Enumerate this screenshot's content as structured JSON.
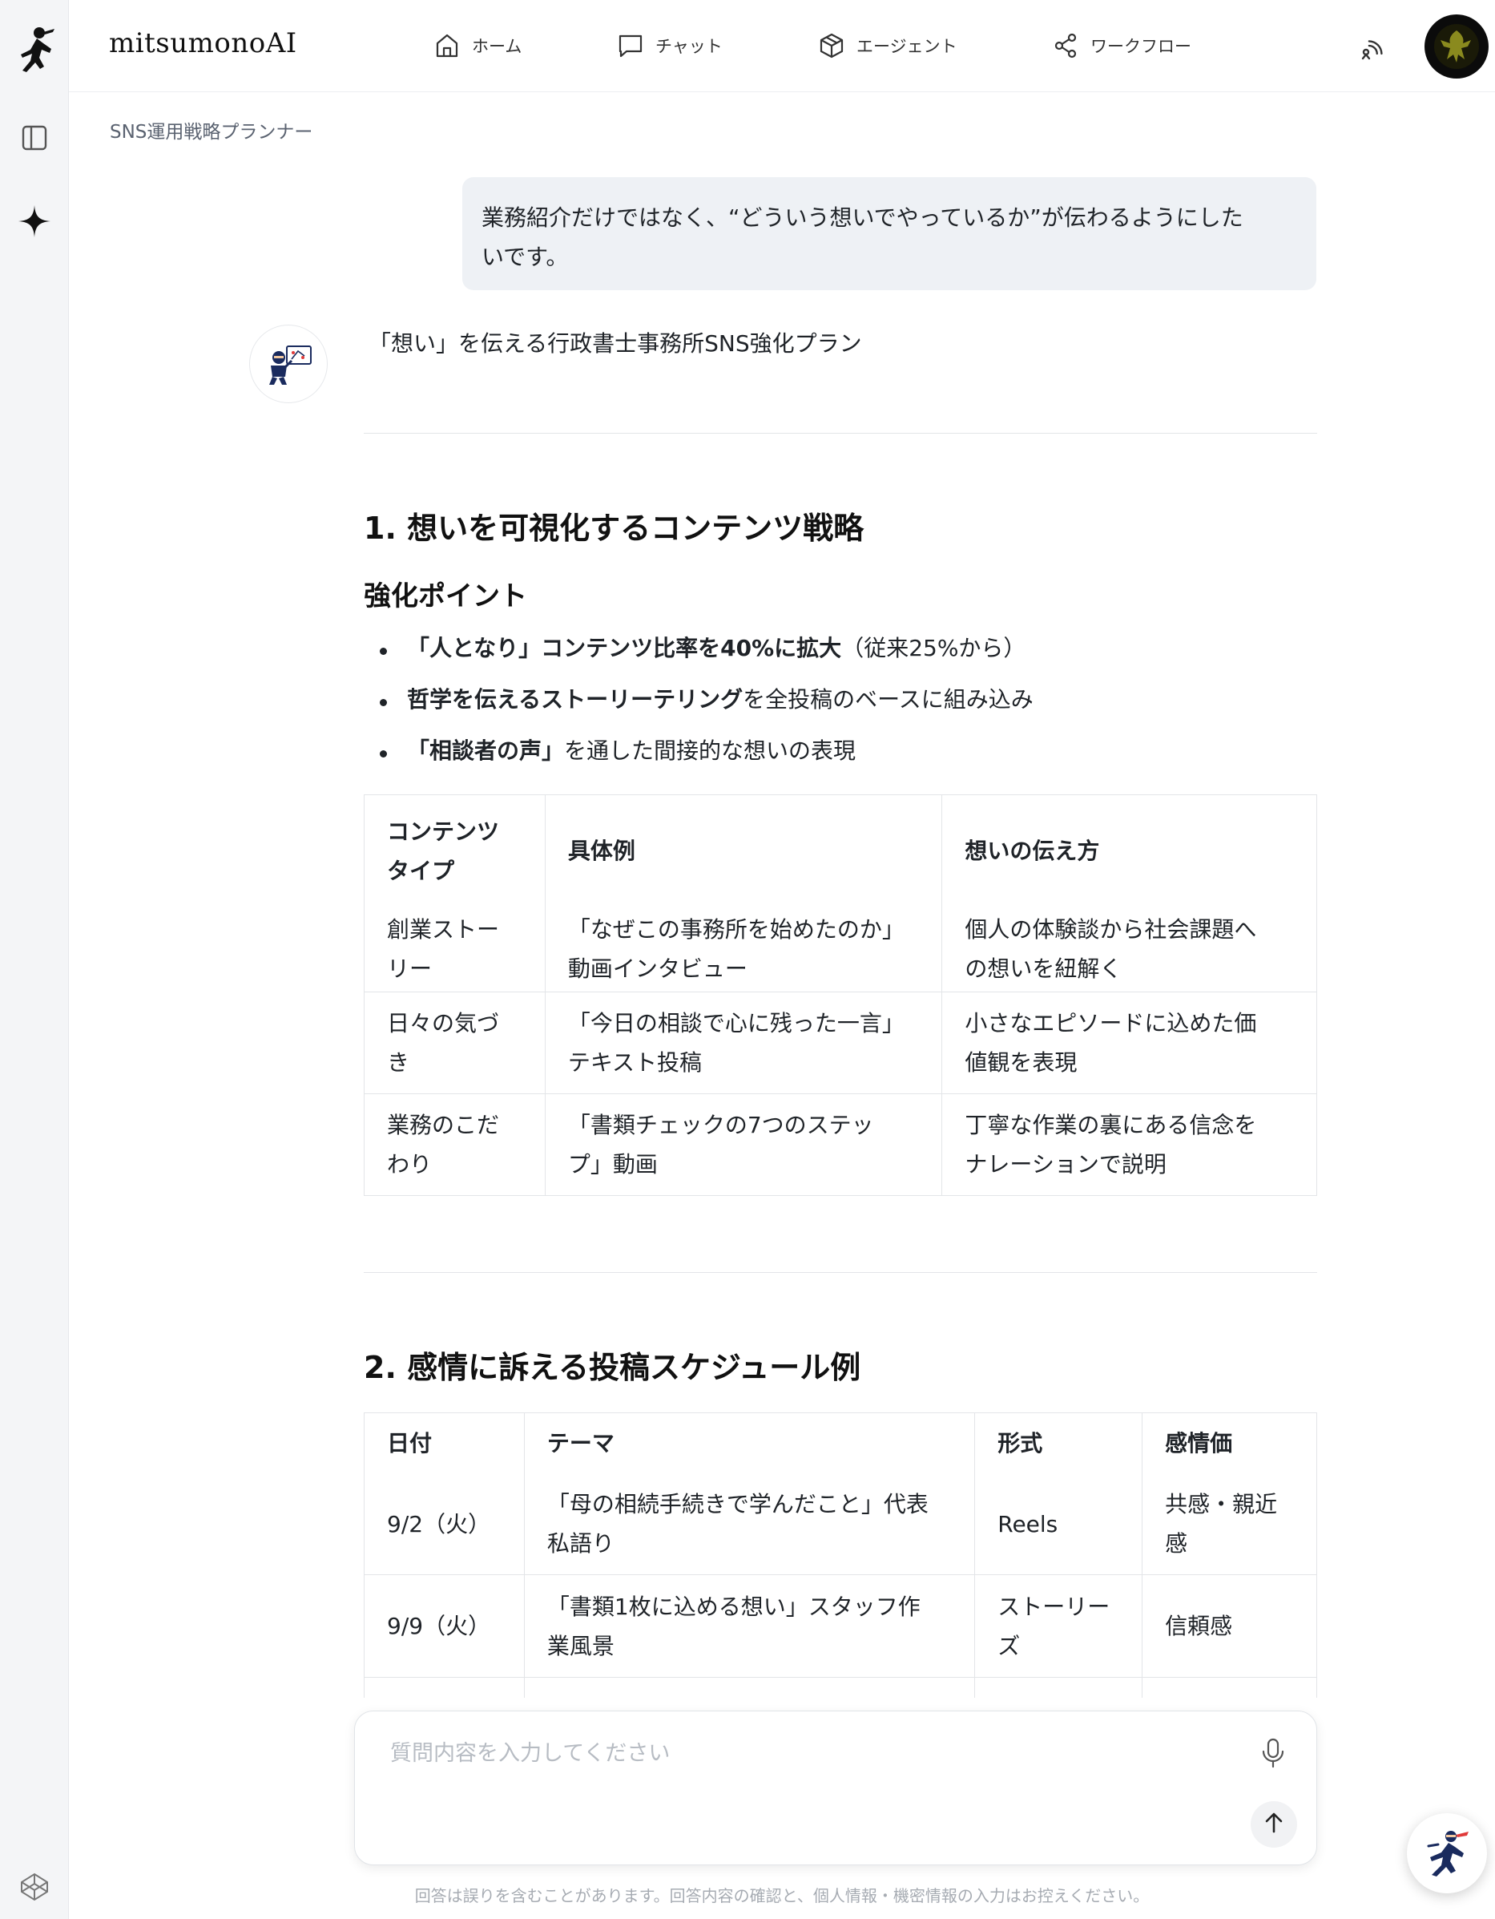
{
  "app": {
    "brand": "mitsumonoAI"
  },
  "nav": {
    "home": "ホーム",
    "chat": "チャット",
    "agent": "エージェント",
    "workflow": "ワークフロー"
  },
  "breadcrumb": "SNS運用戦略プランナー",
  "user_message": {
    "line1": "業務紹介だけではなく、“どういう想いでやっているか”が伝わるようにした",
    "line2": "いです。"
  },
  "assistant": {
    "title": "「想い」を伝える行政書士事務所SNS強化プラン",
    "section1": {
      "heading": "1. 想いを可視化するコンテンツ戦略",
      "subheading": "強化ポイント",
      "bullets": [
        {
          "bold": "「人となり」コンテンツ比率を40%に拡大",
          "rest": "（従来25%から）"
        },
        {
          "bold": "哲学を伝えるストーリーテリング",
          "rest": "を全投稿のベースに組み込み"
        },
        {
          "bold": "「相談者の声」",
          "rest": "を通した間接的な想いの表現"
        }
      ],
      "table": {
        "headers": [
          "コンテンツタイプ",
          "具体例",
          "想いの伝え方"
        ],
        "header_lines": [
          [
            "コンテンツ",
            "タイプ"
          ],
          [
            "具体例"
          ],
          [
            "想いの伝え方"
          ]
        ],
        "rows": [
          [
            [
              "創業ストー",
              "リー"
            ],
            [
              "「なぜこの事務所を始めたのか」",
              "動画インタビュー"
            ],
            [
              "個人の体験談から社会課題へ",
              "の想いを紐解く"
            ]
          ],
          [
            [
              "日々の気づ",
              "き"
            ],
            [
              "「今日の相談で心に残った一言」",
              "テキスト投稿"
            ],
            [
              "小さなエピソードに込めた価",
              "値観を表現"
            ]
          ],
          [
            [
              "業務のこだ",
              "わり"
            ],
            [
              "「書類チェックの7つのステッ",
              "プ」動画"
            ],
            [
              "丁寧な作業の裏にある信念を",
              "ナレーションで説明"
            ]
          ]
        ]
      }
    },
    "section2": {
      "heading": "2. 感情に訴える投稿スケジュール例",
      "table": {
        "headers": [
          "日付",
          "テーマ",
          "形式",
          "感情価"
        ],
        "rows": [
          [
            [
              "9/2（火）"
            ],
            [
              "「母の相続手続きで学んだこと」代表",
              "私語り"
            ],
            [
              "Reels"
            ],
            [
              "共感・親近",
              "感"
            ]
          ],
          [
            [
              "9/9（火）"
            ],
            [
              "「書類1枚に込める想い」スタッフ作",
              "業風景"
            ],
            [
              "ストーリー",
              "ズ"
            ],
            [
              "信頼感"
            ]
          ]
        ]
      }
    }
  },
  "composer": {
    "placeholder": "質問内容を入力してください"
  },
  "disclaimer": "回答は誤りを含むことがあります。回答内容の確認と、個人情報・機密情報の入力はお控えください。",
  "icons": {
    "logo": "ninja-logo-icon",
    "panel": "sidebar-toggle-icon",
    "spark": "sparkle-icon",
    "cube": "codepen-cube-icon",
    "home": "home-icon",
    "chat": "chat-bubble-icon",
    "agent": "package-icon",
    "workflow": "share-nodes-icon",
    "signal": "signal-icon",
    "mic": "microphone-icon",
    "send": "arrow-up-icon"
  },
  "colors": {
    "bubble": "#eef1f5",
    "rail": "#f4f5f7",
    "accent": "#1a2b5e"
  }
}
